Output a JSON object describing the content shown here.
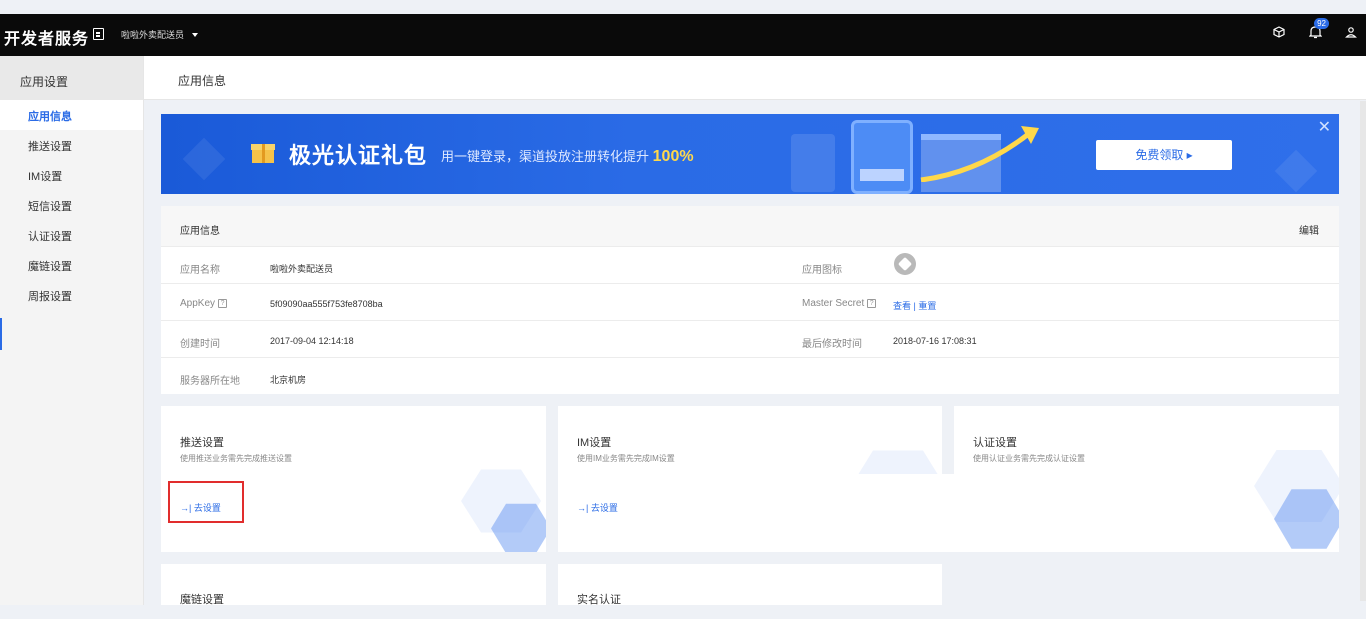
{
  "topbar": {
    "brand": "开发者服务",
    "app_name": "啦啦外卖配送员",
    "notification_count": "92"
  },
  "sidebar": {
    "header": "应用设置",
    "items": [
      {
        "label": "应用信息",
        "active": true
      },
      {
        "label": "推送设置"
      },
      {
        "label": "IM设置"
      },
      {
        "label": "短信设置"
      },
      {
        "label": "认证设置"
      },
      {
        "label": "魔链设置"
      },
      {
        "label": "周报设置"
      }
    ]
  },
  "content_header": "应用信息",
  "banner": {
    "title": "极光认证礼包",
    "subtitle": "用一键登录，渠道投放注册转化提升",
    "highlight": "100%",
    "button": "免费领取 ▸",
    "close": "✕"
  },
  "app_info": {
    "title": "应用信息",
    "edit": "编辑",
    "name_label": "应用名称",
    "name_value": "啦啦外卖配送员",
    "icon_label": "应用图标",
    "appkey_label": "AppKey",
    "appkey_value": "5f09090aa555f753fe8708ba",
    "master_label": "Master Secret",
    "master_view": "查看",
    "master_sep": "|",
    "master_reset": "重置",
    "created_label": "创建时间",
    "created_value": "2017-09-04 12:14:18",
    "modified_label": "最后修改时间",
    "modified_value": "2018-07-16 17:08:31",
    "server_label": "服务器所在地",
    "server_value": "北京机房"
  },
  "services": [
    {
      "title": "推送设置",
      "desc": "使用推送业务需先完成推送设置",
      "action": "→| 去设置"
    },
    {
      "title": "IM设置",
      "desc": "使用IM业务需先完成IM设置",
      "action": "→| 去设置"
    },
    {
      "title": "认证设置",
      "desc": "使用认证业务需先完成认证设置"
    },
    {
      "title": "魔链设置"
    },
    {
      "title": "实名认证"
    }
  ],
  "colors": {
    "accent": "#2a6be6",
    "highlight_box": "#e12d2d",
    "topbar": "#0a0a0a"
  }
}
